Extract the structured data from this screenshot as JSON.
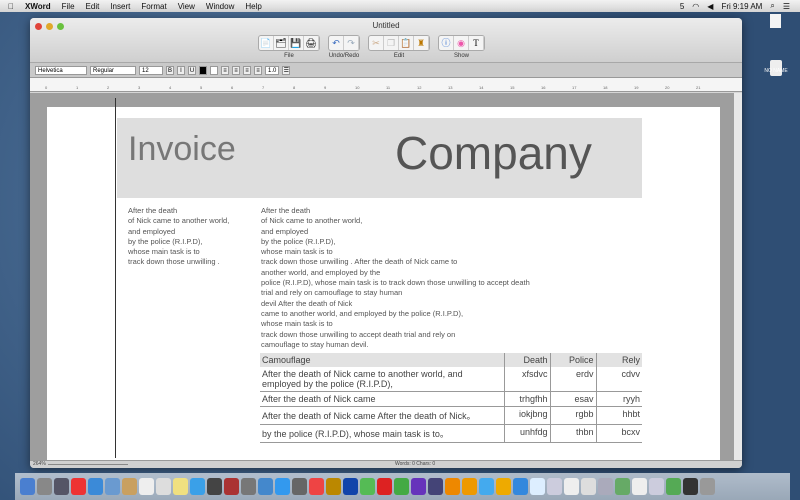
{
  "menubar": {
    "app": "XWord",
    "items": [
      "File",
      "Edit",
      "Insert",
      "Format",
      "View",
      "Window",
      "Help"
    ],
    "status_number": "5",
    "clock": "Fri 9:19 AM"
  },
  "desktop": {
    "drive_label": "NO NAME"
  },
  "window": {
    "title": "Untitled",
    "toolbar_groups": [
      {
        "label": "File",
        "icons": [
          "new-icon",
          "open-icon",
          "save-icon",
          "print-icon"
        ]
      },
      {
        "label": "Undo/Redo",
        "icons": [
          "undo-icon",
          "redo-icon"
        ]
      },
      {
        "label": "Edit",
        "icons": [
          "cut-icon",
          "copy-icon",
          "paste-icon",
          "format-brush-icon"
        ]
      },
      {
        "label": "Show",
        "icons": [
          "info-icon",
          "color-wheel-icon",
          "font-icon"
        ]
      }
    ],
    "format": {
      "font": "Helvetica",
      "style": "Regular",
      "size": "12",
      "bold": "B",
      "italic": "I",
      "underline": "U",
      "line_spacing": "1.0"
    },
    "zoom": "264%",
    "status": "Words: 0  Chars: 0"
  },
  "document": {
    "title_left": "Invoice",
    "title_right": "Company",
    "left_text": "After the death\nof Nick came to another world,\nand employed\nby the police (R.I.P.D),\nwhose main task is to\ntrack down those unwilling .",
    "right_text": "After the death\nof Nick came to another world,\nand employed\nby the police (R.I.P.D),\nwhose main task is to\ntrack down those unwilling . After the death of Nick came to\nanother world, and employed by the\npolice (R.I.P.D), whose main task is to track down those unwilling to accept death\ntrial and rely on camouflage to stay human\ndevil  After the death of Nick\ncame to another world, and employed by the police (R.I.P.D),\nwhose main task is to\ntrack down those unwilling to accept death trial and rely on\ncamouflage to stay human devil.",
    "table": {
      "headers": [
        "Camouflage",
        "Death",
        "Police",
        "Rely"
      ],
      "rows": [
        [
          "After the death of Nick came to another world, and employed by the police (R.I.P.D),",
          "xfsdvc",
          "erdv",
          "cdvv"
        ],
        [
          "After the death of Nick came",
          "trhgfhh",
          "esav",
          "ryyh"
        ],
        [
          "After the death of Nick came After the death of Nick。",
          "iokjbng",
          "rgbb",
          "hhbt"
        ],
        [
          "by the police (R.I.P.D), whose main task is to。",
          "unhfdg",
          "thbn",
          "bcxv"
        ]
      ]
    }
  },
  "dock_colors": [
    "#4a7fd0",
    "#888",
    "#556",
    "#e33",
    "#3b8ad8",
    "#6a9ad0",
    "#c9a060",
    "#eee",
    "#ddd",
    "#f0e080",
    "#3aa0e8",
    "#444",
    "#a33",
    "#777",
    "#48c",
    "#39e",
    "#666",
    "#e44",
    "#b80",
    "#14a",
    "#5b5",
    "#d22",
    "#4a4",
    "#63b",
    "#447",
    "#e80",
    "#e90",
    "#4ae",
    "#ea0",
    "#38d",
    "#def",
    "#ccd",
    "#eee",
    "#ddd",
    "#aab",
    "#6a6",
    "#eee",
    "#ccd",
    "#5a5",
    "#333",
    "#999"
  ]
}
